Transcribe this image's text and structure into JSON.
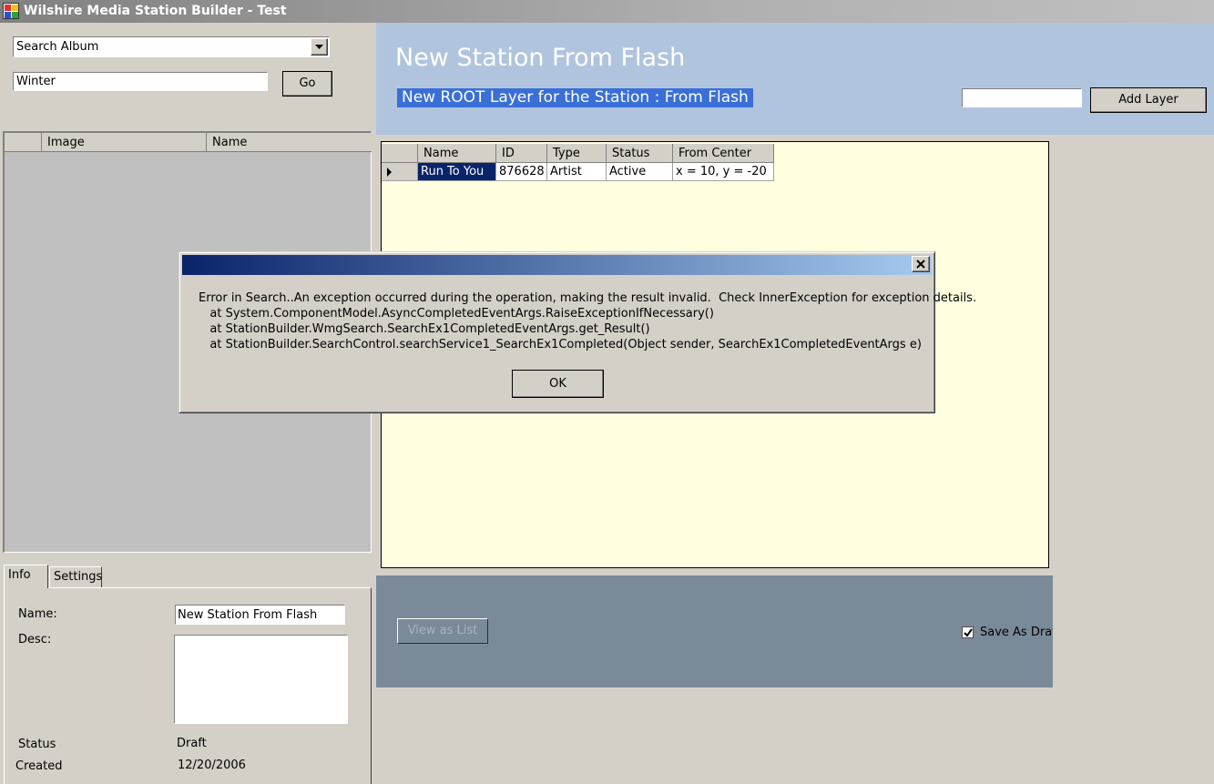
{
  "window": {
    "title": "Wilshire Media Station Builder - Test"
  },
  "search": {
    "mode_selected": "Search Album",
    "query": "Winter",
    "go_label": "Go",
    "results_columns": [
      "",
      "Image",
      "Name"
    ]
  },
  "header": {
    "station_title": "New Station From Flash",
    "layer_label": "New ROOT Layer for the Station : From Flash",
    "layer_input_value": "",
    "add_layer_label": "Add Layer"
  },
  "layers_grid": {
    "columns": [
      "Name",
      "ID",
      "Type",
      "Status",
      "From Center"
    ],
    "rows": [
      {
        "name": "Run To You",
        "id": "876628",
        "type": "Artist",
        "status": "Active",
        "from_center": "x = 10, y = -20"
      }
    ]
  },
  "bottom": {
    "view_as_list_label": "View as List",
    "save_as_draft_label": "Save As Draft",
    "save_as_draft_checked": true
  },
  "tabs": [
    {
      "label": "Info",
      "active": true
    },
    {
      "label": "Settings",
      "active": false
    }
  ],
  "info": {
    "name_label": "Name:",
    "name_value": "New Station From Flash",
    "desc_label": "Desc:",
    "desc_value": "",
    "status_label": "Status",
    "status_value": "Draft",
    "created_label": "Created",
    "created_value": "12/20/2006"
  },
  "dialog": {
    "title": "",
    "message_lines": [
      "Error in Search..An exception occurred during the operation, making the result invalid.  Check InnerException for exception details.",
      "   at System.ComponentModel.AsyncCompletedEventArgs.RaiseExceptionIfNecessary()",
      "   at StationBuilder.WmgSearch.SearchEx1CompletedEventArgs.get_Result()",
      "   at StationBuilder.SearchControl.searchService1_SearchEx1Completed(Object sender, SearchEx1CompletedEventArgs e)"
    ],
    "ok_label": "OK"
  },
  "colors": {
    "window_bg": "#d4d0c8",
    "header_bg": "#b0c4de",
    "grid_bg": "#ffffe0",
    "bottom_panel_bg": "#7a8a99",
    "selection": "#0a246a",
    "dialog_title_start": "#0a246a",
    "dialog_title_end": "#a6caf0"
  },
  "icons": [
    "app-icon",
    "dropdown-arrow-icon",
    "row-pointer-icon",
    "checkmark-icon",
    "close-icon"
  ]
}
